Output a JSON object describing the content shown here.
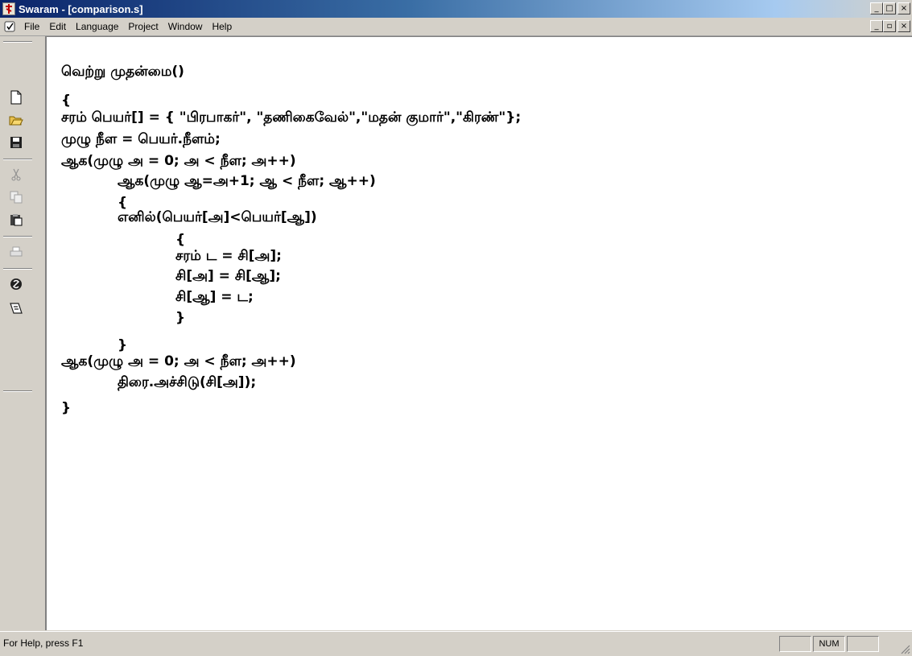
{
  "window": {
    "title": "Swaram - [comparison.s]",
    "caption_buttons": {
      "minimize": "_",
      "maximize": "□",
      "close": "×"
    },
    "mdi_buttons": {
      "minimize": "_",
      "restore": "▫",
      "close": "×"
    }
  },
  "menu": {
    "items": [
      "File",
      "Edit",
      "Language",
      "Project",
      "Window",
      "Help"
    ]
  },
  "toolbar": {
    "buttons": [
      {
        "name": "new-document-icon",
        "enabled": true
      },
      {
        "name": "open-folder-icon",
        "enabled": true
      },
      {
        "name": "save-disk-icon",
        "enabled": true
      },
      {
        "name": "cut-scissors-icon",
        "enabled": false
      },
      {
        "name": "copy-icon",
        "enabled": false
      },
      {
        "name": "paste-clipboard-icon",
        "enabled": true
      },
      {
        "name": "print-icon",
        "enabled": false
      },
      {
        "name": "compile-icon",
        "enabled": true
      },
      {
        "name": "run-icon",
        "enabled": true
      }
    ]
  },
  "editor": {
    "lines": [
      "வெற்று முதன்மை()",
      "{",
      "சரம் பெயர்[] = { \"பிரபாகர்\", \"தணிகைவேல்\",\"மதன் குமார்\",\"கிரண்\"};",
      "முழு நீள = பெயர்.நீளம்;",
      "ஆக(முழு அ = 0; அ < நீள; அ++)",
      "ஆக(முழு ஆ=அ+1; ஆ < நீள; ஆ++)",
      "{",
      "எனில்(பெயர்[அ]<பெயர்[ஆ])",
      "{",
      "சரம் ட = சி[அ];",
      "சி[அ] = சி[ஆ];",
      "சி[ஆ] = ட;",
      "}",
      "}",
      "ஆக(முழு அ = 0; அ < நீள; அ++)",
      "திரை.அச்சிடு(சி[அ]);",
      "}"
    ]
  },
  "statusbar": {
    "help_text": "For Help, press F1",
    "indicator": "NUM"
  }
}
